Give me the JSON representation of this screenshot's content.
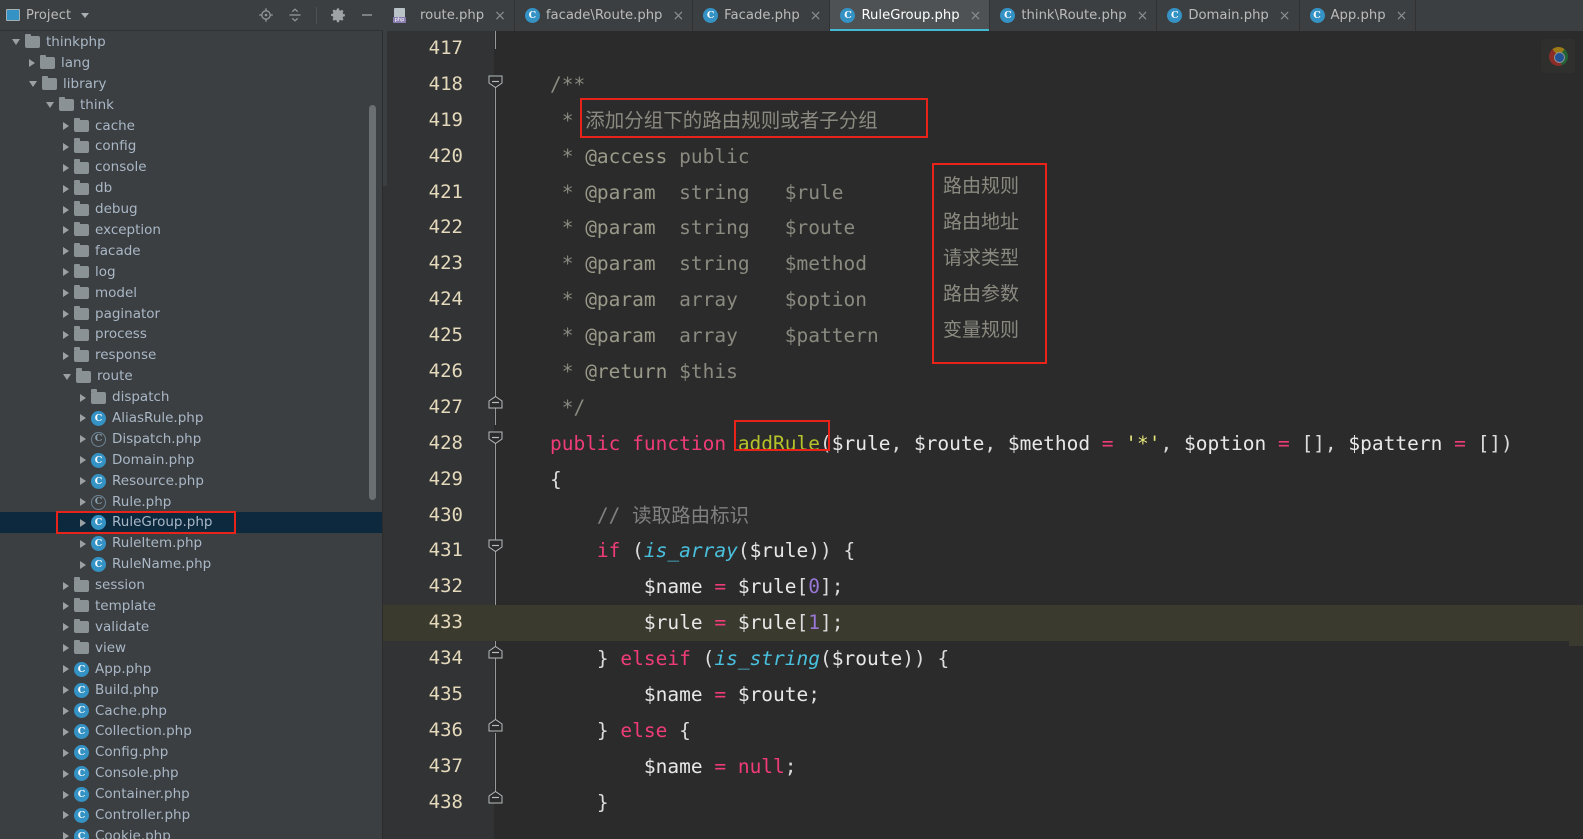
{
  "sidebar": {
    "title": "Project",
    "title_icon": "project-panel-icon",
    "caret_icon": "chevron-down-icon",
    "tools": [
      {
        "name": "locate-target-icon",
        "label": "Select Opened File"
      },
      {
        "name": "collapse-all-icon",
        "label": "Collapse All"
      },
      {
        "name": "gear-icon",
        "label": "Settings"
      },
      {
        "name": "minimize-icon",
        "label": "Hide"
      }
    ],
    "tree": [
      {
        "label": "thinkphp",
        "indent": 0,
        "arrow": "open",
        "icon": "folder"
      },
      {
        "label": "lang",
        "indent": 1,
        "arrow": "closed",
        "icon": "folder"
      },
      {
        "label": "library",
        "indent": 1,
        "arrow": "open",
        "icon": "folder"
      },
      {
        "label": "think",
        "indent": 2,
        "arrow": "open",
        "icon": "folder"
      },
      {
        "label": "cache",
        "indent": 3,
        "arrow": "closed",
        "icon": "folder"
      },
      {
        "label": "config",
        "indent": 3,
        "arrow": "closed",
        "icon": "folder"
      },
      {
        "label": "console",
        "indent": 3,
        "arrow": "closed",
        "icon": "folder"
      },
      {
        "label": "db",
        "indent": 3,
        "arrow": "closed",
        "icon": "folder"
      },
      {
        "label": "debug",
        "indent": 3,
        "arrow": "closed",
        "icon": "folder"
      },
      {
        "label": "exception",
        "indent": 3,
        "arrow": "closed",
        "icon": "folder"
      },
      {
        "label": "facade",
        "indent": 3,
        "arrow": "closed",
        "icon": "folder"
      },
      {
        "label": "log",
        "indent": 3,
        "arrow": "closed",
        "icon": "folder"
      },
      {
        "label": "model",
        "indent": 3,
        "arrow": "closed",
        "icon": "folder"
      },
      {
        "label": "paginator",
        "indent": 3,
        "arrow": "closed",
        "icon": "folder"
      },
      {
        "label": "process",
        "indent": 3,
        "arrow": "closed",
        "icon": "folder"
      },
      {
        "label": "response",
        "indent": 3,
        "arrow": "closed",
        "icon": "folder"
      },
      {
        "label": "route",
        "indent": 3,
        "arrow": "open",
        "icon": "folder"
      },
      {
        "label": "dispatch",
        "indent": 4,
        "arrow": "closed",
        "icon": "folder"
      },
      {
        "label": "AliasRule.php",
        "indent": 4,
        "arrow": "closed",
        "icon": "class"
      },
      {
        "label": "Dispatch.php",
        "indent": 4,
        "arrow": "closed",
        "icon": "abstract-class"
      },
      {
        "label": "Domain.php",
        "indent": 4,
        "arrow": "closed",
        "icon": "class"
      },
      {
        "label": "Resource.php",
        "indent": 4,
        "arrow": "closed",
        "icon": "class"
      },
      {
        "label": "Rule.php",
        "indent": 4,
        "arrow": "closed",
        "icon": "abstract-class"
      },
      {
        "label": "RuleGroup.php",
        "indent": 4,
        "arrow": "closed",
        "icon": "class",
        "selected": true,
        "annotated": true
      },
      {
        "label": "RuleItem.php",
        "indent": 4,
        "arrow": "closed",
        "icon": "class"
      },
      {
        "label": "RuleName.php",
        "indent": 4,
        "arrow": "closed",
        "icon": "class"
      },
      {
        "label": "session",
        "indent": 3,
        "arrow": "closed",
        "icon": "folder"
      },
      {
        "label": "template",
        "indent": 3,
        "arrow": "closed",
        "icon": "folder"
      },
      {
        "label": "validate",
        "indent": 3,
        "arrow": "closed",
        "icon": "folder"
      },
      {
        "label": "view",
        "indent": 3,
        "arrow": "closed",
        "icon": "folder"
      },
      {
        "label": "App.php",
        "indent": 3,
        "arrow": "closed",
        "icon": "class"
      },
      {
        "label": "Build.php",
        "indent": 3,
        "arrow": "closed",
        "icon": "class"
      },
      {
        "label": "Cache.php",
        "indent": 3,
        "arrow": "closed",
        "icon": "class"
      },
      {
        "label": "Collection.php",
        "indent": 3,
        "arrow": "closed",
        "icon": "class"
      },
      {
        "label": "Config.php",
        "indent": 3,
        "arrow": "closed",
        "icon": "class"
      },
      {
        "label": "Console.php",
        "indent": 3,
        "arrow": "closed",
        "icon": "class"
      },
      {
        "label": "Container.php",
        "indent": 3,
        "arrow": "closed",
        "icon": "class"
      },
      {
        "label": "Controller.php",
        "indent": 3,
        "arrow": "closed",
        "icon": "class"
      },
      {
        "label": "Cookie.php",
        "indent": 3,
        "arrow": "closed",
        "icon": "class"
      }
    ]
  },
  "tabs": [
    {
      "label": "route.php",
      "icon": "php-file-icon",
      "active": false,
      "close": "×"
    },
    {
      "label": "facade\\Route.php",
      "icon": "php-class-icon",
      "active": false,
      "close": "×"
    },
    {
      "label": "Facade.php",
      "icon": "php-class-icon",
      "active": false,
      "close": "×"
    },
    {
      "label": "RuleGroup.php",
      "icon": "php-class-icon",
      "active": true,
      "close": "×"
    },
    {
      "label": "think\\Route.php",
      "icon": "php-class-icon",
      "active": false,
      "close": "×"
    },
    {
      "label": "Domain.php",
      "icon": "php-class-icon",
      "active": false,
      "close": "×"
    },
    {
      "label": "App.php",
      "icon": "php-class-icon",
      "active": false,
      "close": "×"
    }
  ],
  "editor": {
    "file": "RuleGroup.php",
    "first_line": 417,
    "current_line": 433,
    "lines": [
      {
        "n": 417,
        "segments": []
      },
      {
        "n": 418,
        "segments": [
          {
            "t": "    /**",
            "c": "c-doc"
          }
        ],
        "fold": "start"
      },
      {
        "n": 419,
        "segments": [
          {
            "t": "     * ",
            "c": "c-doc"
          },
          {
            "t": "添加分组下的路由规则或者子分组",
            "c": "c-doc"
          }
        ]
      },
      {
        "n": 420,
        "segments": [
          {
            "t": "     * ",
            "c": "c-doc"
          },
          {
            "t": "@access",
            "c": "c-tag"
          },
          {
            "t": " public",
            "c": "c-doc"
          }
        ]
      },
      {
        "n": 421,
        "segments": [
          {
            "t": "     * ",
            "c": "c-doc"
          },
          {
            "t": "@param",
            "c": "c-tag"
          },
          {
            "t": "  string   $rule",
            "c": "c-doc"
          }
        ]
      },
      {
        "n": 422,
        "segments": [
          {
            "t": "     * ",
            "c": "c-doc"
          },
          {
            "t": "@param",
            "c": "c-tag"
          },
          {
            "t": "  string   $route",
            "c": "c-doc"
          }
        ]
      },
      {
        "n": 423,
        "segments": [
          {
            "t": "     * ",
            "c": "c-doc"
          },
          {
            "t": "@param",
            "c": "c-tag"
          },
          {
            "t": "  string   $method",
            "c": "c-doc"
          }
        ]
      },
      {
        "n": 424,
        "segments": [
          {
            "t": "     * ",
            "c": "c-doc"
          },
          {
            "t": "@param",
            "c": "c-tag"
          },
          {
            "t": "  array    $option",
            "c": "c-doc"
          }
        ]
      },
      {
        "n": 425,
        "segments": [
          {
            "t": "     * ",
            "c": "c-doc"
          },
          {
            "t": "@param",
            "c": "c-tag"
          },
          {
            "t": "  array    $pattern",
            "c": "c-doc"
          }
        ]
      },
      {
        "n": 426,
        "segments": [
          {
            "t": "     * ",
            "c": "c-doc"
          },
          {
            "t": "@return",
            "c": "c-tag"
          },
          {
            "t": " $this",
            "c": "c-doc"
          }
        ]
      },
      {
        "n": 427,
        "segments": [
          {
            "t": "     */",
            "c": "c-doc"
          }
        ],
        "fold": "end"
      },
      {
        "n": 428,
        "segments": [
          {
            "t": "    ",
            "c": "c-plain"
          },
          {
            "t": "public function ",
            "c": "c-kw"
          },
          {
            "t": "addRule",
            "c": "c-fn"
          },
          {
            "t": "(",
            "c": "c-plain"
          },
          {
            "t": "$rule",
            "c": "c-var"
          },
          {
            "t": ", ",
            "c": "c-plain"
          },
          {
            "t": "$route",
            "c": "c-var"
          },
          {
            "t": ", ",
            "c": "c-plain"
          },
          {
            "t": "$method",
            "c": "c-var"
          },
          {
            "t": " = ",
            "c": "c-op"
          },
          {
            "t": "'*'",
            "c": "c-str"
          },
          {
            "t": ", ",
            "c": "c-plain"
          },
          {
            "t": "$option",
            "c": "c-var"
          },
          {
            "t": " = ",
            "c": "c-op"
          },
          {
            "t": "[]",
            "c": "c-plain"
          },
          {
            "t": ", ",
            "c": "c-plain"
          },
          {
            "t": "$pattern",
            "c": "c-var"
          },
          {
            "t": " = ",
            "c": "c-op"
          },
          {
            "t": "[])",
            "c": "c-plain"
          }
        ],
        "fold": "start"
      },
      {
        "n": 429,
        "segments": [
          {
            "t": "    {",
            "c": "c-plain"
          }
        ]
      },
      {
        "n": 430,
        "segments": [
          {
            "t": "        ",
            "c": "c-plain"
          },
          {
            "t": "// 读取路由标识",
            "c": "c-cmt"
          }
        ]
      },
      {
        "n": 431,
        "segments": [
          {
            "t": "        ",
            "c": "c-plain"
          },
          {
            "t": "if",
            "c": "c-kw"
          },
          {
            "t": " (",
            "c": "c-plain"
          },
          {
            "t": "is_array",
            "c": "c-builtin"
          },
          {
            "t": "(",
            "c": "c-plain"
          },
          {
            "t": "$rule",
            "c": "c-var"
          },
          {
            "t": ")) {",
            "c": "c-plain"
          }
        ],
        "fold": "start"
      },
      {
        "n": 432,
        "segments": [
          {
            "t": "            ",
            "c": "c-plain"
          },
          {
            "t": "$name",
            "c": "c-var"
          },
          {
            "t": " = ",
            "c": "c-op"
          },
          {
            "t": "$rule",
            "c": "c-var"
          },
          {
            "t": "[",
            "c": "c-plain"
          },
          {
            "t": "0",
            "c": "c-num"
          },
          {
            "t": "];",
            "c": "c-plain"
          }
        ]
      },
      {
        "n": 433,
        "segments": [
          {
            "t": "            ",
            "c": "c-plain"
          },
          {
            "t": "$rule",
            "c": "c-var"
          },
          {
            "t": " = ",
            "c": "c-op"
          },
          {
            "t": "$rule",
            "c": "c-var"
          },
          {
            "t": "[",
            "c": "c-plain"
          },
          {
            "t": "1",
            "c": "c-num"
          },
          {
            "t": "];",
            "c": "c-plain"
          }
        ],
        "current": true
      },
      {
        "n": 434,
        "segments": [
          {
            "t": "        } ",
            "c": "c-plain"
          },
          {
            "t": "elseif",
            "c": "c-kw"
          },
          {
            "t": " (",
            "c": "c-plain"
          },
          {
            "t": "is_string",
            "c": "c-builtin"
          },
          {
            "t": "(",
            "c": "c-plain"
          },
          {
            "t": "$route",
            "c": "c-var"
          },
          {
            "t": ")) {",
            "c": "c-plain"
          }
        ],
        "fold": "start"
      },
      {
        "n": 435,
        "segments": [
          {
            "t": "            ",
            "c": "c-plain"
          },
          {
            "t": "$name",
            "c": "c-var"
          },
          {
            "t": " = ",
            "c": "c-op"
          },
          {
            "t": "$route",
            "c": "c-var"
          },
          {
            "t": ";",
            "c": "c-plain"
          }
        ]
      },
      {
        "n": 436,
        "segments": [
          {
            "t": "        } ",
            "c": "c-plain"
          },
          {
            "t": "else",
            "c": "c-kw"
          },
          {
            "t": " {",
            "c": "c-plain"
          }
        ],
        "fold": "end"
      },
      {
        "n": 437,
        "segments": [
          {
            "t": "            ",
            "c": "c-plain"
          },
          {
            "t": "$name",
            "c": "c-var"
          },
          {
            "t": " = ",
            "c": "c-op"
          },
          {
            "t": "null",
            "c": "c-null"
          },
          {
            "t": ";",
            "c": "c-plain"
          }
        ]
      },
      {
        "n": 438,
        "segments": [
          {
            "t": "        }",
            "c": "c-plain"
          }
        ],
        "fold": "end"
      }
    ]
  },
  "annotations": {
    "color": "#e8241a",
    "boxes": [
      {
        "name": "annotation-box-summary",
        "target": "line 419 Chinese doc summary"
      },
      {
        "name": "annotation-box-params",
        "target": "param descriptions column"
      },
      {
        "name": "annotation-box-addrule",
        "target": "addRule method name"
      },
      {
        "name": "annotation-box-rulegroup",
        "target": "RuleGroup.php tree item"
      }
    ],
    "param_labels": [
      "路由规则",
      "路由地址",
      "请求类型",
      "路由参数",
      "变量规则"
    ]
  },
  "overlay": {
    "browser_icon": "chrome-icon"
  }
}
